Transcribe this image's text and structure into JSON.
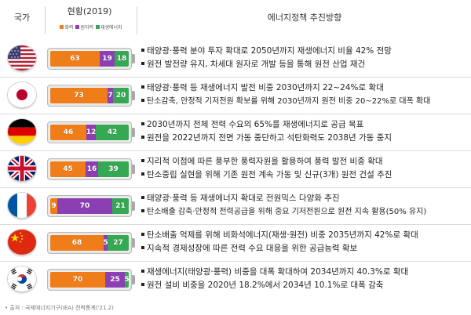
{
  "header": {
    "country": "국가",
    "status_title": "현황(2019)",
    "legend": [
      {
        "label": "화력",
        "color": "#ef7d1a"
      },
      {
        "label": "원자력",
        "color": "#8b3fb3"
      },
      {
        "label": "재생에너지",
        "color": "#34a853"
      }
    ],
    "policy_title": "에너지정책 추진방향"
  },
  "colors": {
    "thermal": "#ef7d1a",
    "nuclear": "#8b3fb3",
    "renewable": "#34a853"
  },
  "chart_data": {
    "type": "bar",
    "stacked": true,
    "categories": [
      "미국",
      "일본",
      "독일",
      "영국",
      "프랑스",
      "중국",
      "한국"
    ],
    "series": [
      {
        "name": "화력",
        "values": [
          63,
          73,
          46,
          45,
          9,
          68,
          70
        ]
      },
      {
        "name": "원자력",
        "values": [
          19,
          7,
          12,
          16,
          70,
          5,
          25
        ]
      },
      {
        "name": "재생에너지",
        "values": [
          18,
          20,
          42,
          39,
          21,
          27,
          5
        ]
      }
    ]
  },
  "rows": [
    {
      "flag": "usa-flag-icon",
      "values": {
        "thermal": "63",
        "nuclear": "19",
        "renewable": "18"
      },
      "bullets": [
        "태양광·풍력 분야 투자 확대로 2050년까지 재생에너지 비율 42% 전망",
        "원전 발전량 유지, 차세대 원자로 개발 등을 통해 원전 산업 재건"
      ]
    },
    {
      "flag": "japan-flag-icon",
      "values": {
        "thermal": "73",
        "nuclear": "7",
        "renewable": "20"
      },
      "bullets": [
        "태양광·풍력 등 재생에너지 발전 비중 2030년까지 22~24%로 확대",
        "탄소감축, 안정적 기저전원 확보를 위해 2030년까지 원전 비중 20~22%로 대폭 확대"
      ]
    },
    {
      "flag": "germany-flag-icon",
      "values": {
        "thermal": "46",
        "nuclear": "12",
        "renewable": "42"
      },
      "bullets": [
        "2030년까지 전체 전력 수요의 65%를 재생에너지로 공급 목표",
        "원전을 2022년까지 전면 가동 중단하고 석탄화력도 2038년 가동 중지"
      ]
    },
    {
      "flag": "uk-flag-icon",
      "values": {
        "thermal": "45",
        "nuclear": "16",
        "renewable": "39"
      },
      "bullets": [
        "지리적 이점에 따른 풍부한 풍력자원을 활용하여 풍력 발전 비중 확대",
        "탄소중립 실현을 위해 기존 원전 계속 가동 및 신규(3개) 원전 건설 추진"
      ]
    },
    {
      "flag": "france-flag-icon",
      "values": {
        "thermal": "9",
        "nuclear": "70",
        "renewable": "21"
      },
      "bullets": [
        "태양광·풍력 등 재생에너지 확대로 전원믹스 다양화 추진",
        "탄소배출 감축·안정적 전력공급을 위해 중요 기저전원으로 원전 지속 활용(50% 유지)"
      ]
    },
    {
      "flag": "china-flag-icon",
      "values": {
        "thermal": "68",
        "nuclear": "5",
        "renewable": "27"
      },
      "bullets": [
        "탄소배출 억제를 위해 비화석에너지(재생·원전) 비중 2035년까지 42%로 확대",
        "지속적 경제성장에 따른 전력 수요 대응을 위한 공급능력 확보"
      ]
    },
    {
      "flag": "korea-flag-icon",
      "values": {
        "thermal": "70",
        "nuclear": "25",
        "renewable": "5"
      },
      "bullets": [
        "재생에너지(태양광·풍력) 비중을 대폭 확대하여 2034년까지 40.3%로 확대",
        "원전 설비 비중을 2020년 18.2%에서 2034년 10.1%로 대폭 감축"
      ]
    }
  ],
  "source": "• 출처 : 국제에너지기구(IEA) 전력통계('21.2)"
}
